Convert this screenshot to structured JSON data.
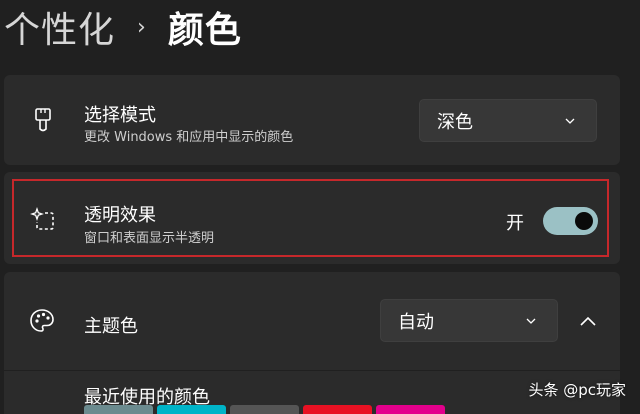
{
  "breadcrumb": {
    "parent": "个性化",
    "separator": "›",
    "current": "颜色"
  },
  "mode_setting": {
    "icon": "paintbrush-icon",
    "title": "选择模式",
    "subtitle": "更改 Windows 和应用中显示的颜色",
    "selected": "深色"
  },
  "transparency_setting": {
    "icon": "transparency-sparkle-icon",
    "title": "透明效果",
    "subtitle": "窗口和表面显示半透明",
    "state_label": "开",
    "enabled": true
  },
  "accent_setting": {
    "icon": "palette-icon",
    "title": "主题色",
    "selected": "自动",
    "expanded": true
  },
  "recent_colors": {
    "title": "最近使用的颜色",
    "swatches": [
      "#6b8b8f",
      "#00b4c8",
      "#555555",
      "#e81123",
      "#e3008c"
    ]
  },
  "watermark": {
    "text": "头条 @pc玩家"
  },
  "colors": {
    "background": "#202020",
    "card": "#2b2b2b",
    "toggle_on": "#9bc1c5",
    "highlight": "#c6282b"
  }
}
